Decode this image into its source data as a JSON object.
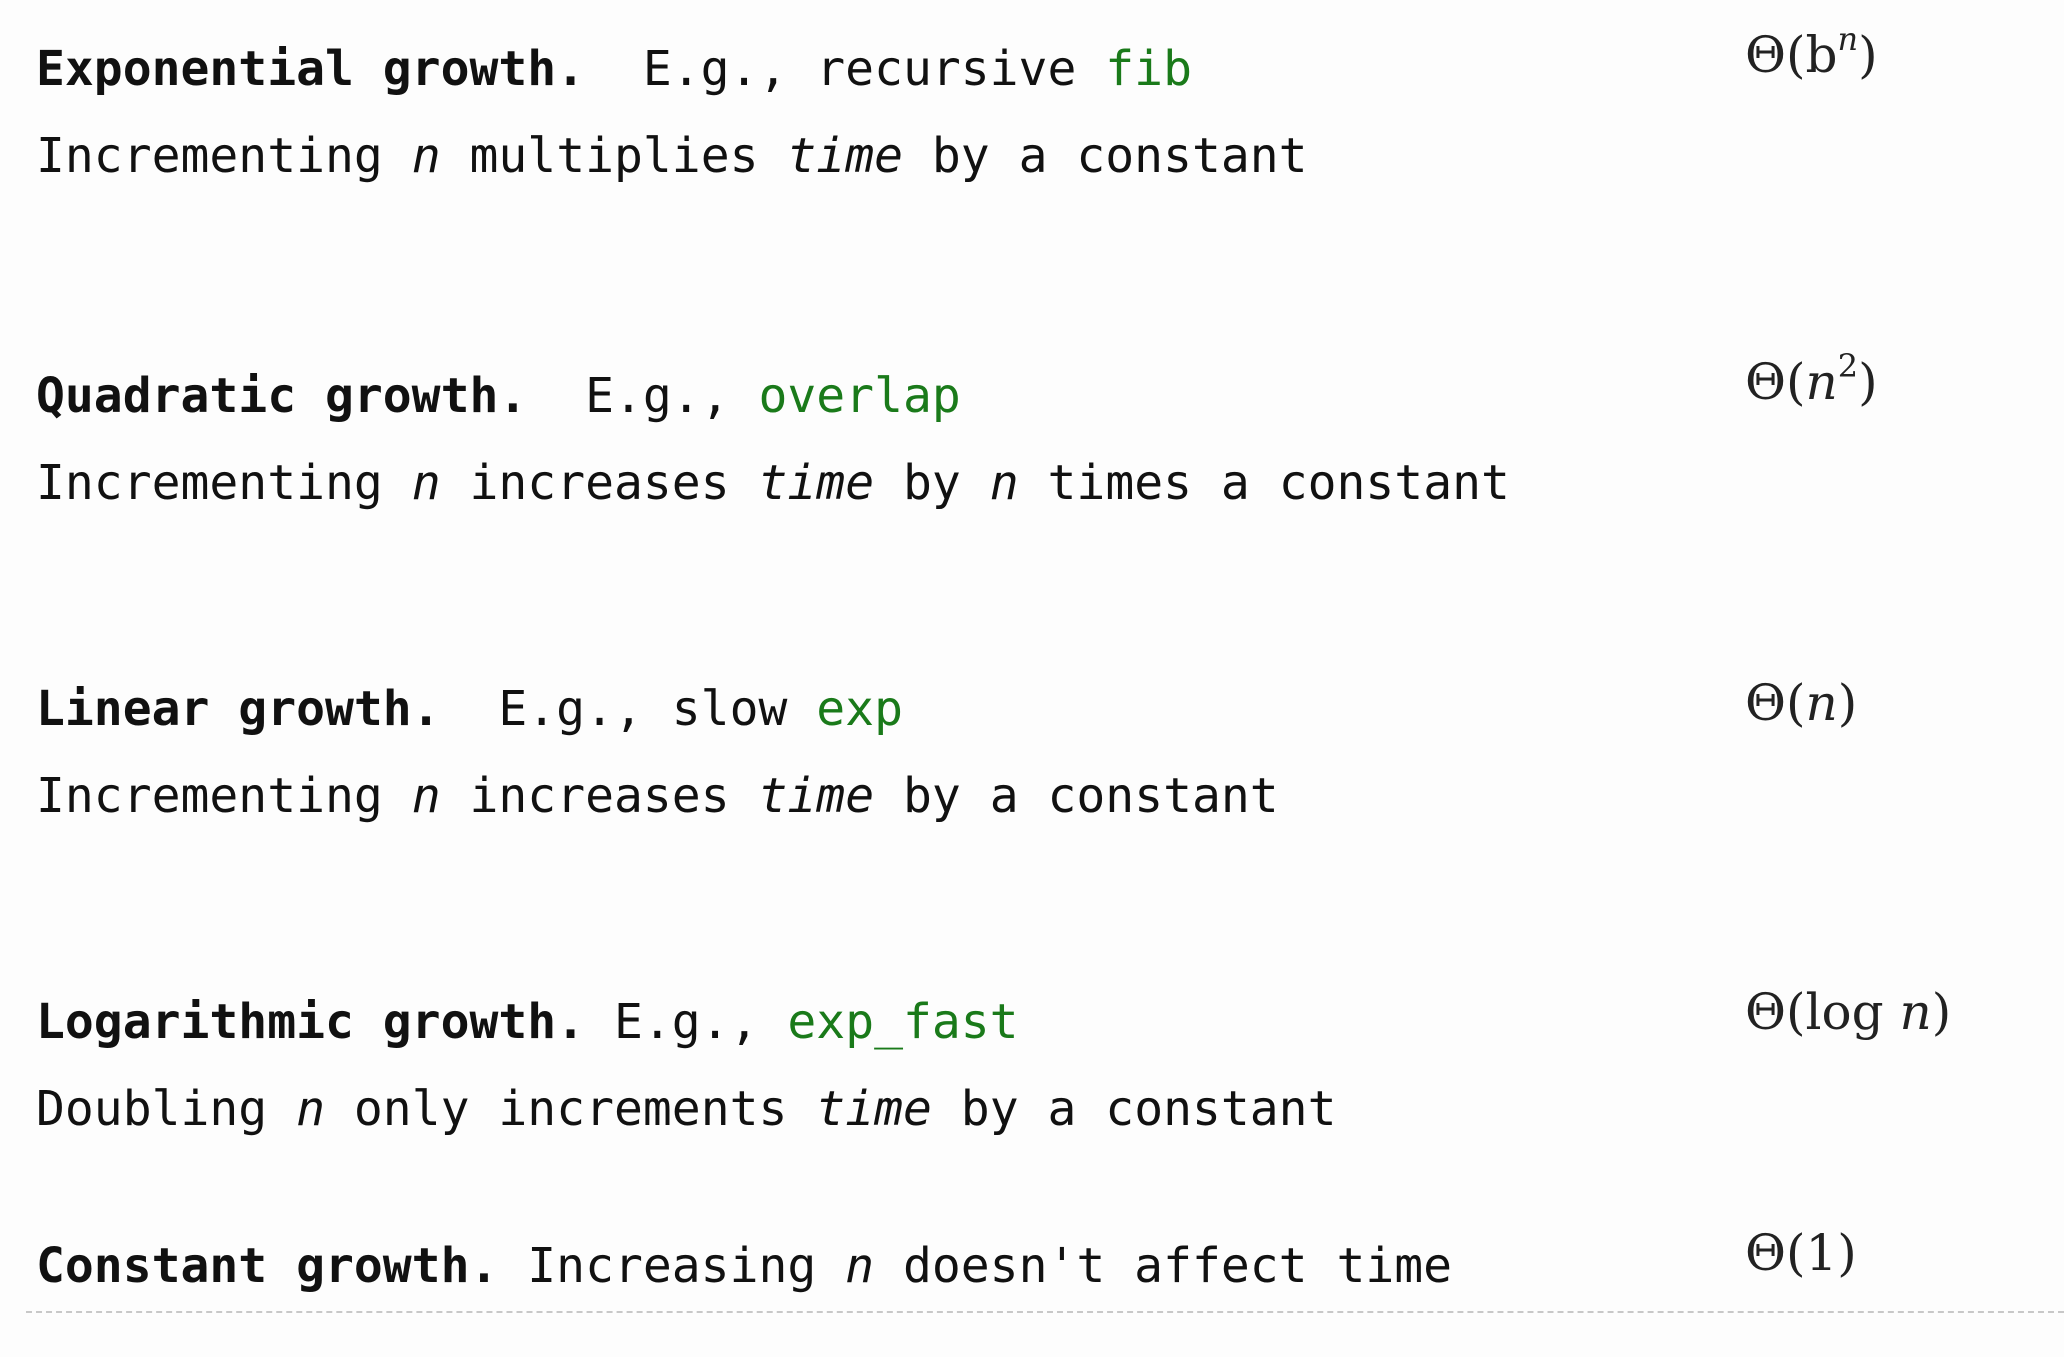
{
  "sections": [
    {
      "title": "Exponential growth.",
      "eg_prefix": "E.g., recursive",
      "eg_code": "fib",
      "desc_1": "Incrementing",
      "desc_var": "n",
      "desc_2": "multiplies",
      "desc_time": "time",
      "desc_3": "by a constant",
      "complexity_base": "Θ(b",
      "complexity_exp": "n",
      "complexity_close": ")"
    },
    {
      "title": "Quadratic growth.",
      "eg_prefix": "E.g.,",
      "eg_code": "overlap",
      "desc_1": "Incrementing",
      "desc_var": "n",
      "desc_2": "increases",
      "desc_time": "time",
      "desc_3": "by",
      "desc_var2": "n",
      "desc_4": "times a constant",
      "complexity_base": "Θ(",
      "complexity_var": "n",
      "complexity_exp": "2",
      "complexity_close": ")"
    },
    {
      "title": "Linear growth.",
      "eg_prefix": "E.g., slow",
      "eg_code": "exp",
      "desc_1": "Incrementing",
      "desc_var": "n",
      "desc_2": "increases",
      "desc_time": "time",
      "desc_3": "by a constant",
      "complexity_base": "Θ(",
      "complexity_var": "n",
      "complexity_close": ")"
    },
    {
      "title": "Logarithmic growth.",
      "eg_prefix": "E.g.,",
      "eg_code": "exp_fast",
      "desc_1": "Doubling",
      "desc_var": "n",
      "desc_2": "only increments",
      "desc_time": "time",
      "desc_3": "by a constant",
      "complexity_base": "Θ(log ",
      "complexity_var": "n",
      "complexity_close": ")"
    },
    {
      "title": "Constant growth.",
      "desc_1": "Increasing",
      "desc_var": "n",
      "desc_2": "doesn't affect time",
      "complexity": "Θ(1)"
    }
  ],
  "colors": {
    "code": "#1a7a1a",
    "text": "#111111",
    "background": "#fdfdfd"
  }
}
